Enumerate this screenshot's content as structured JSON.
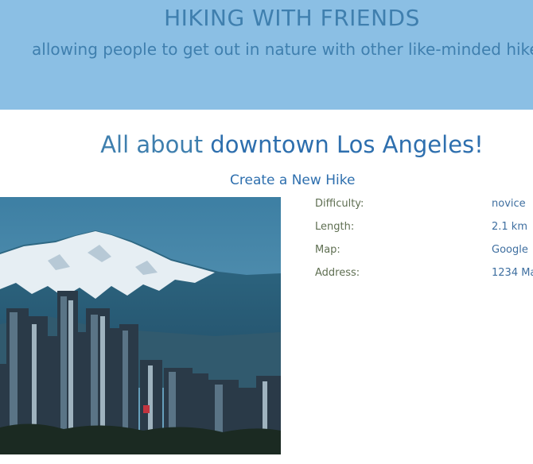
{
  "header": {
    "title": "HIKING WITH FRIENDS",
    "tagline": "allowing people to get out in nature with other like-minded hike"
  },
  "main": {
    "heading_prefix": "All about ",
    "heading_place": "downtown Los Angeles!",
    "create_link": "Create a New Hike",
    "image": {
      "description_icon": "city-mountain-photo"
    },
    "details": [
      {
        "label": "Difficulty:",
        "value": "novice"
      },
      {
        "label": "Length:",
        "value": "2.1 km"
      },
      {
        "label": "Map:",
        "value": "Google"
      },
      {
        "label": "Address:",
        "value": "1234 Ma"
      }
    ]
  },
  "colors": {
    "header_bg": "#8bbfe4",
    "title_text": "#3f7fae",
    "link": "#2e6fae",
    "label_text": "#5f6f52"
  }
}
